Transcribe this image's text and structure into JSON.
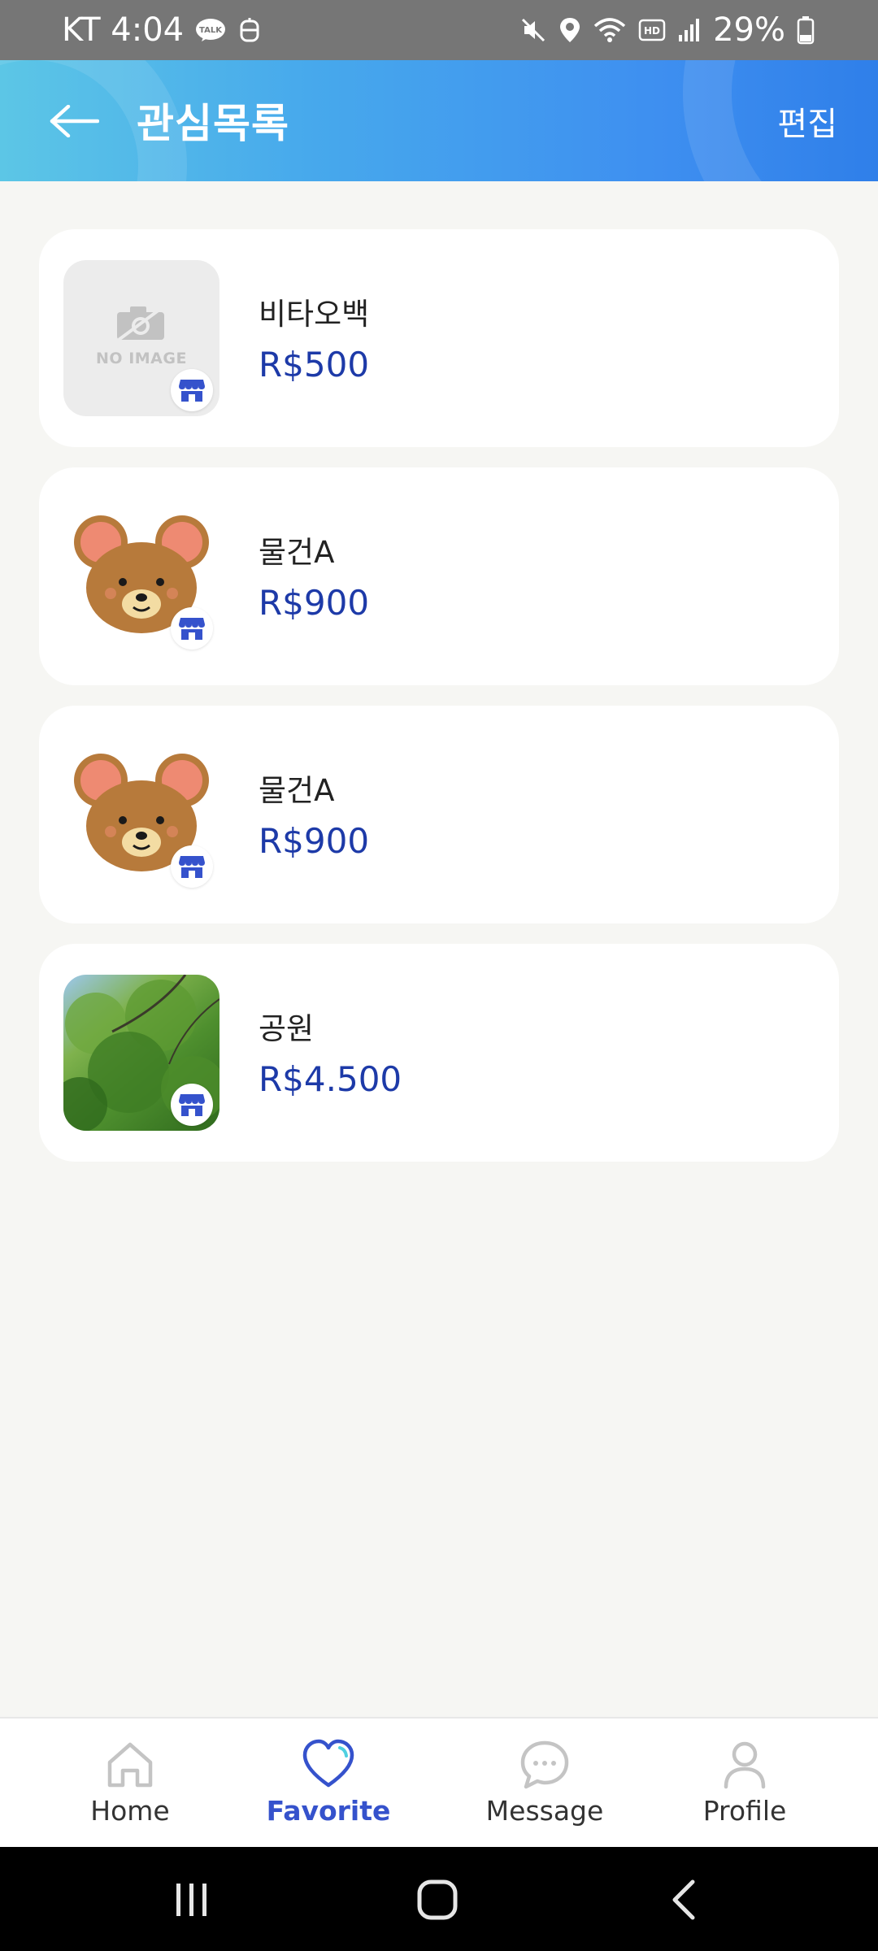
{
  "status_bar": {
    "carrier_time": "KT 4:04",
    "talk_badge": "TALK",
    "battery_percent": "29%"
  },
  "header": {
    "title": "관심목록",
    "edit_label": "편집",
    "back_icon": "arrow-left-icon"
  },
  "favorites": [
    {
      "name": "비타오백",
      "price": "R$500",
      "thumbnail": "no-image",
      "no_image_text": "NO IMAGE"
    },
    {
      "name": "물건A",
      "price": "R$900",
      "thumbnail": "bear"
    },
    {
      "name": "물건A",
      "price": "R$900",
      "thumbnail": "bear"
    },
    {
      "name": "공원",
      "price": "R$4.500",
      "thumbnail": "tree-photo"
    }
  ],
  "bottom_nav": {
    "items": [
      {
        "label": "Home",
        "icon": "home-icon"
      },
      {
        "label": "Favorite",
        "icon": "heart-icon",
        "active": true
      },
      {
        "label": "Message",
        "icon": "chat-bubble-icon"
      },
      {
        "label": "Profile",
        "icon": "person-icon"
      }
    ]
  },
  "colors": {
    "header_gradient_start": "#5cc6e6",
    "header_gradient_end": "#2f7fe9",
    "price": "#1d3aa8",
    "active_nav": "#3552cc",
    "page_background": "#f6f6f3"
  }
}
